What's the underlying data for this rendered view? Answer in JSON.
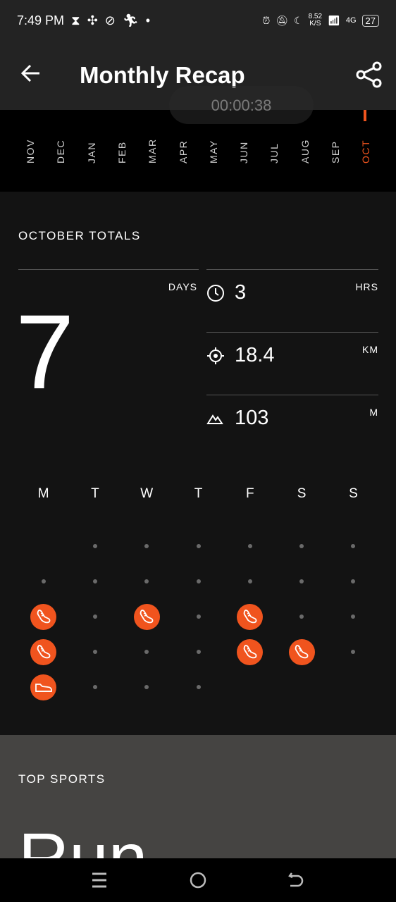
{
  "status_bar": {
    "time": "7:49 PM",
    "net_speed": "8.52",
    "net_unit": "K/S",
    "network": "4G",
    "battery": "27"
  },
  "header": {
    "title": "Monthly Recap"
  },
  "timer": "00:00:38",
  "months": [
    {
      "label": "NOV"
    },
    {
      "label": "DEC"
    },
    {
      "label": "JAN"
    },
    {
      "label": "FEB"
    },
    {
      "label": "MAR"
    },
    {
      "label": "APR"
    },
    {
      "label": "MAY"
    },
    {
      "label": "JUN"
    },
    {
      "label": "JUL"
    },
    {
      "label": "AUG"
    },
    {
      "label": "SEP"
    },
    {
      "label": "OCT",
      "selected": true
    }
  ],
  "totals": {
    "label": "OCTOBER TOTALS",
    "days": {
      "value": "7",
      "unit": "DAYS"
    },
    "stats": [
      {
        "icon": "clock-icon",
        "value": "3",
        "unit": "HRS"
      },
      {
        "icon": "location-target-icon",
        "value": "18.4",
        "unit": "KM"
      },
      {
        "icon": "elevation-mountain-icon",
        "value": "103",
        "unit": "M"
      }
    ]
  },
  "calendar": {
    "weekdays": [
      "M",
      "T",
      "W",
      "T",
      "F",
      "S",
      "S"
    ],
    "weeks": [
      [
        "",
        "d",
        "d",
        "d",
        "d",
        "d",
        "d"
      ],
      [
        "d",
        "d",
        "d",
        "d",
        "d",
        "d",
        "d"
      ],
      [
        "run",
        "d",
        "run",
        "d",
        "run",
        "d",
        "d"
      ],
      [
        "run",
        "d",
        "d",
        "d",
        "run",
        "run",
        "d"
      ],
      [
        "walk",
        "d",
        "d",
        "d",
        "",
        "",
        ""
      ]
    ]
  },
  "top_sports": {
    "label": "TOP SPORTS",
    "sport": "Run"
  },
  "colors": {
    "accent": "#f0541e",
    "header_bg": "#232323",
    "main_bg": "#131313",
    "top_sports_bg": "#454442"
  }
}
